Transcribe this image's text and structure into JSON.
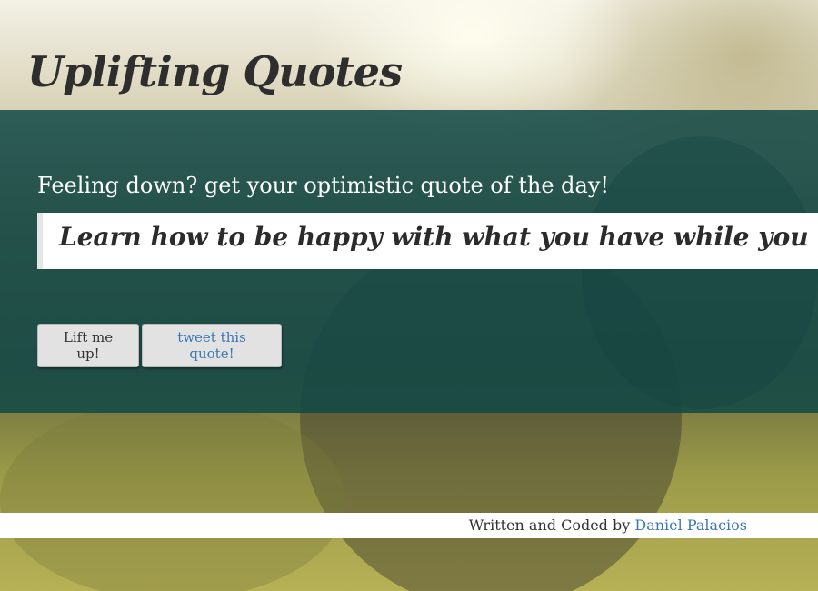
{
  "header": {
    "title": "Uplifting Quotes"
  },
  "main": {
    "tagline": "Feeling down? get your optimistic quote of the day!",
    "quote": "Learn how to be happy with what you have while you pursue all that you want.",
    "buttons": {
      "lift_label": "Lift me up!",
      "tweet_label": "tweet this quote!"
    }
  },
  "footer": {
    "credit_prefix": "Written and Coded by",
    "author_name": "Daniel Palacios"
  },
  "colors": {
    "panel": "#124846",
    "link": "#3a78b5"
  }
}
